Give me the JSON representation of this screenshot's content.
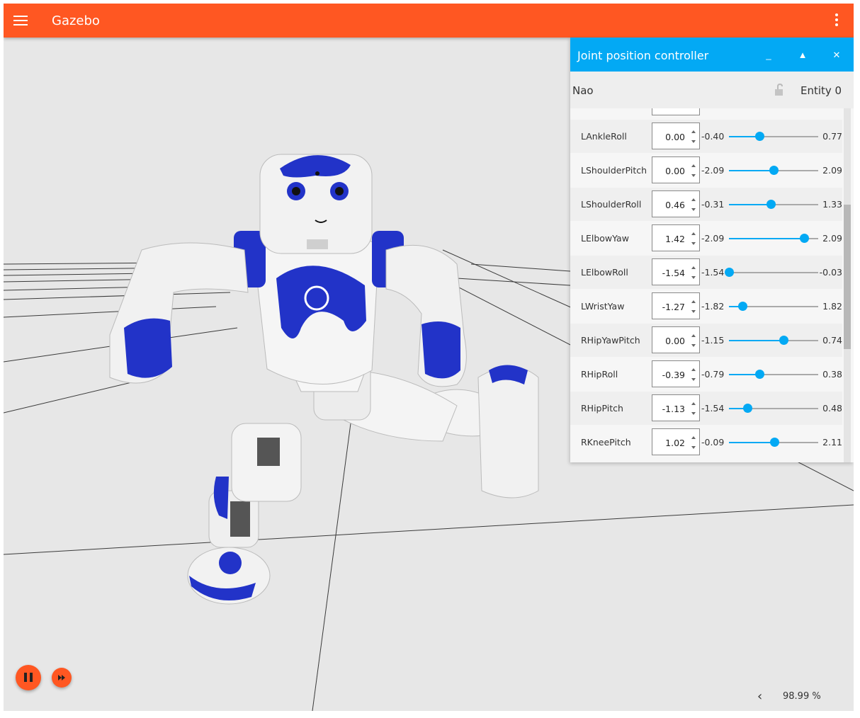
{
  "app": {
    "title": "Gazebo"
  },
  "panel": {
    "title": "Joint position controller",
    "buttons": {
      "minimize": "_",
      "expand": "▲",
      "close": "✕"
    },
    "model_name": "Nao",
    "entity_label": "Entity 0",
    "joints": [
      {
        "name": "LAnkleRoll",
        "value": "0.00",
        "min": "-0.40",
        "max": "0.77"
      },
      {
        "name": "LShoulderPitch",
        "value": "0.00",
        "min": "-2.09",
        "max": "2.09"
      },
      {
        "name": "LShoulderRoll",
        "value": "0.46",
        "min": "-0.31",
        "max": "1.33"
      },
      {
        "name": "LElbowYaw",
        "value": "1.42",
        "min": "-2.09",
        "max": "2.09"
      },
      {
        "name": "LElbowRoll",
        "value": "-1.54",
        "min": "-1.54",
        "max": "-0.03"
      },
      {
        "name": "LWristYaw",
        "value": "-1.27",
        "min": "-1.82",
        "max": "1.82"
      },
      {
        "name": "RHipYawPitch",
        "value": "0.00",
        "min": "-1.15",
        "max": "0.74"
      },
      {
        "name": "RHipRoll",
        "value": "-0.39",
        "min": "-0.79",
        "max": "0.38"
      },
      {
        "name": "RHipPitch",
        "value": "-1.13",
        "min": "-1.54",
        "max": "0.48"
      },
      {
        "name": "RKneePitch",
        "value": "1.02",
        "min": "-0.09",
        "max": "2.11"
      }
    ]
  },
  "playback": {
    "rtf_arrow": "‹",
    "real_time_factor": "98.99 %"
  },
  "colors": {
    "topbar": "#ff5722",
    "panel_header": "#03a9f4",
    "slider": "#03a9f4",
    "robot_accent": "#2233c8"
  }
}
